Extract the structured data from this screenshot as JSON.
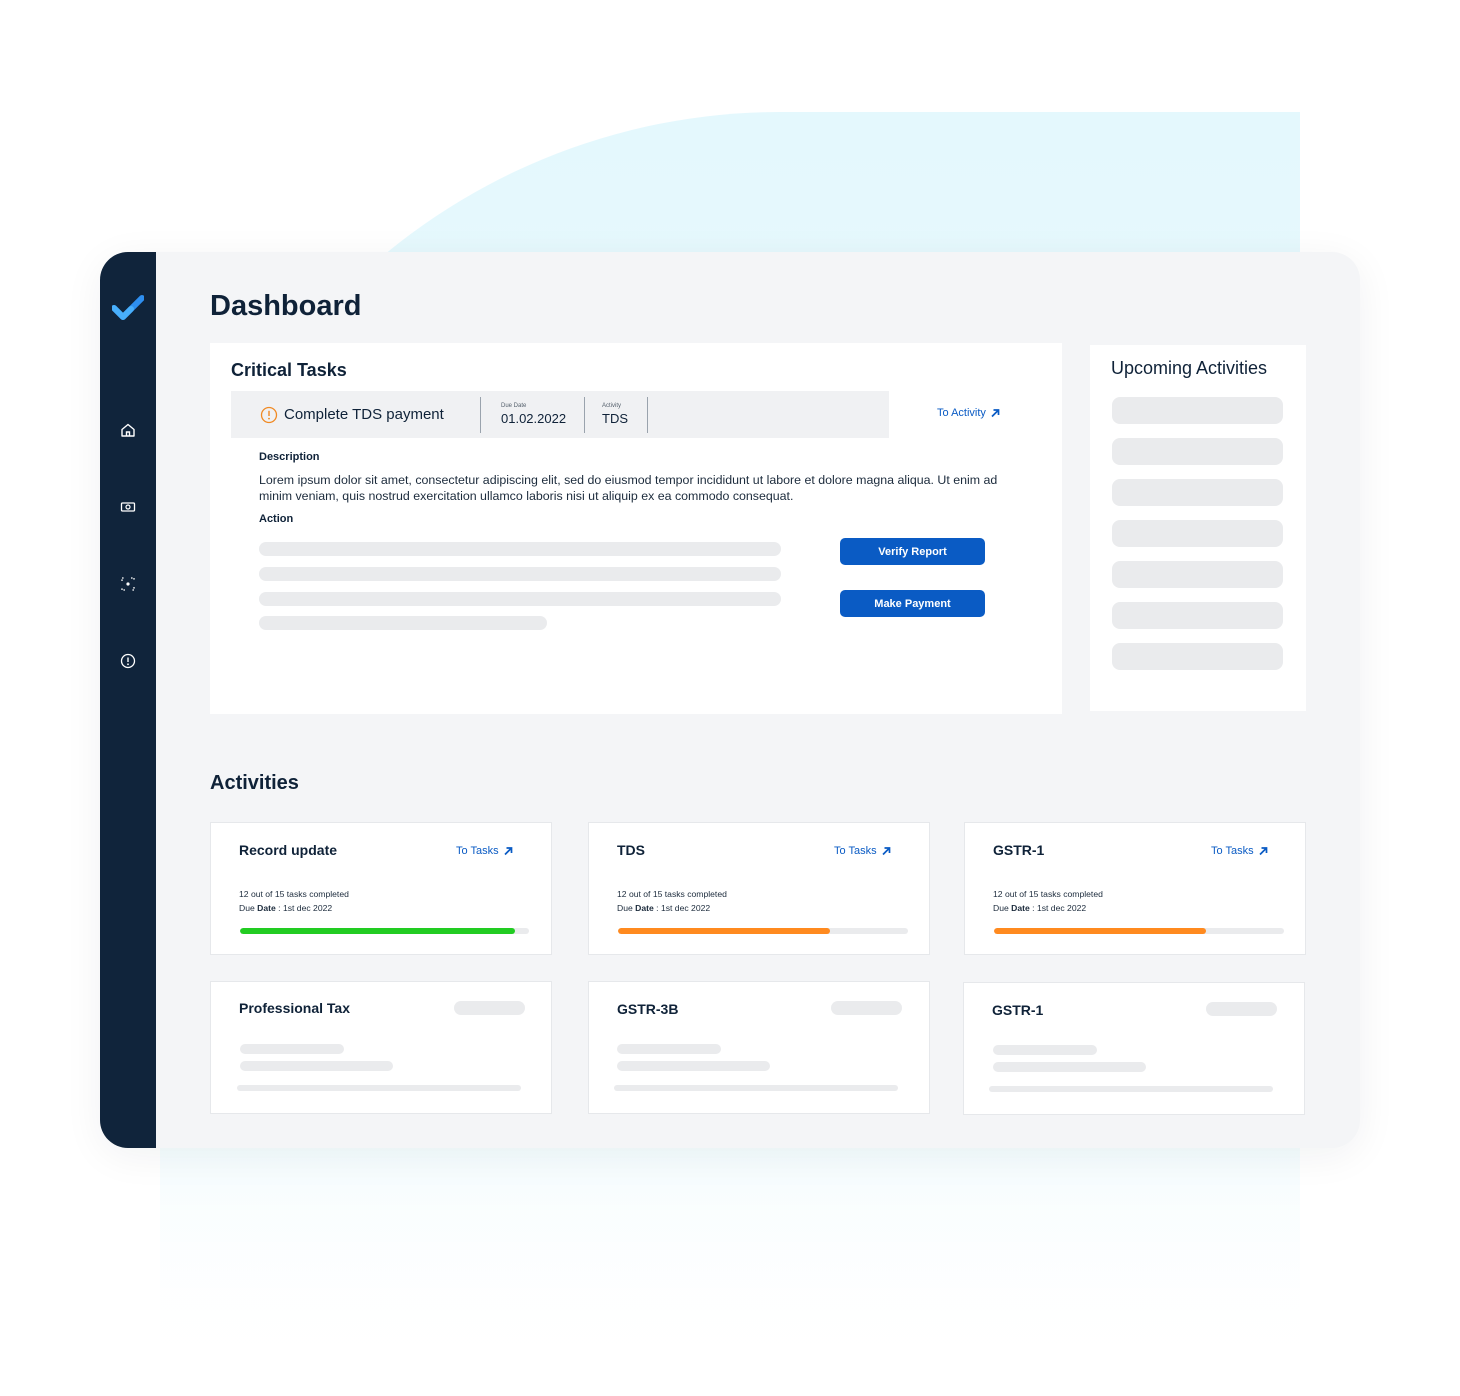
{
  "page": {
    "title": "Dashboard"
  },
  "sidebar": {
    "logo_icon": "checkmark-logo-icon",
    "items": [
      {
        "icon": "home-icon"
      },
      {
        "icon": "payment-icon"
      },
      {
        "icon": "focus-icon"
      },
      {
        "icon": "alert-icon"
      }
    ]
  },
  "critical_tasks": {
    "heading": "Critical Tasks",
    "task": {
      "name": "Complete TDS payment",
      "icon": "warning-circle-icon",
      "due_date_label": "Due Date",
      "due_date": "01.02.2022",
      "activity_label": "Activity",
      "activity": "TDS"
    },
    "to_activity_link": "To Activity",
    "description_label": "Description",
    "description": "Lorem ipsum dolor sit amet, consectetur adipiscing elit, sed do eiusmod tempor incididunt ut labore et dolore magna aliqua. Ut enim ad minim veniam, quis nostrud exercitation ullamco laboris nisi ut aliquip ex ea commodo consequat.",
    "action_label": "Action",
    "buttons": {
      "verify": "Verify Report",
      "pay": "Make Payment"
    }
  },
  "upcoming": {
    "heading": "Upcoming Activities"
  },
  "activities": {
    "heading": "Activities",
    "cards": [
      {
        "title": "Record update",
        "link": "To Tasks",
        "progress_text": "12 out of 15 tasks completed",
        "due_label": "Due",
        "due_bold": "Date",
        "due_value": " : 1st dec 2022",
        "progress": 0.95,
        "color": "#22cc22"
      },
      {
        "title": "TDS",
        "link": "To Tasks",
        "progress_text": "12 out of 15 tasks completed",
        "due_label": "Due",
        "due_bold": "Date",
        "due_value": " : 1st dec 2022",
        "progress": 0.73,
        "color": "#ff8a1f"
      },
      {
        "title": "GSTR-1",
        "link": "To Tasks",
        "progress_text": "12 out of 15 tasks completed",
        "due_label": "Due",
        "due_bold": "Date",
        "due_value": " : 1st dec 2022",
        "progress": 0.73,
        "color": "#ff8a1f"
      },
      {
        "title": "Professional Tax"
      },
      {
        "title": "GSTR-3B"
      },
      {
        "title": "GSTR-1"
      }
    ]
  },
  "colors": {
    "sidebar": "#10243b",
    "accent": "#0a5bc4",
    "warning": "#f08a24"
  }
}
